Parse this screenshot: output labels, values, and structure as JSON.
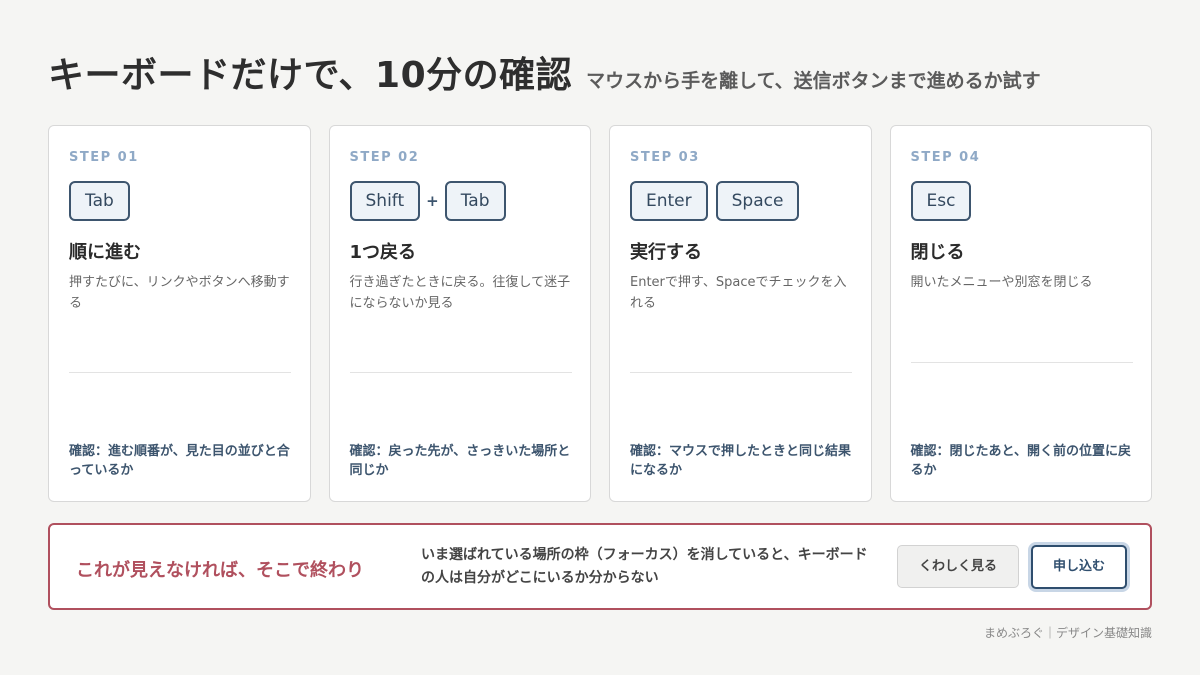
{
  "header": {
    "title": "キーボードだけで、10分の確認",
    "subtitle": "マウスから手を離して、送信ボタンまで進めるか試す"
  },
  "steps": [
    {
      "label": "STEP 01",
      "keys": [
        "Tab"
      ],
      "title": "順に進む",
      "description": "押すたびに、リンクやボタンへ移動する",
      "check": "確認：進む順番が、見た目の並びと合っているか"
    },
    {
      "label": "STEP 02",
      "keys": [
        "Shift",
        "Tab"
      ],
      "plus": "+",
      "title": "1つ戻る",
      "description": "行き過ぎたときに戻る。往復して迷子にならないか見る",
      "check": "確認：戻った先が、さっきいた場所と同じか"
    },
    {
      "label": "STEP 03",
      "keys": [
        "Enter",
        "Space"
      ],
      "title": "実行する",
      "description": "Enterで押す、Spaceでチェックを入れる",
      "check": "確認：マウスで押したときと同じ結果になるか"
    },
    {
      "label": "STEP 04",
      "keys": [
        "Esc"
      ],
      "title": "閉じる",
      "description": "開いたメニューや別窓を閉じる",
      "check": "確認：閉じたあと、開く前の位置に戻るか"
    }
  ],
  "alert": {
    "title": "これが見えなければ、そこで終わり",
    "description": "いま選ばれている場所の枠（フォーカス）を消していると、キーボードの人は自分がどこにいるか分からない",
    "secondary_button": "くわしく見る",
    "primary_button": "申し込む"
  },
  "footer": {
    "credit": "まめぶろぐ｜デザイン基礎知識"
  },
  "colors": {
    "accent": "#3d556e",
    "step_label": "#8fa9c6",
    "alert": "#b0505e",
    "background": "#f5f5f3"
  }
}
